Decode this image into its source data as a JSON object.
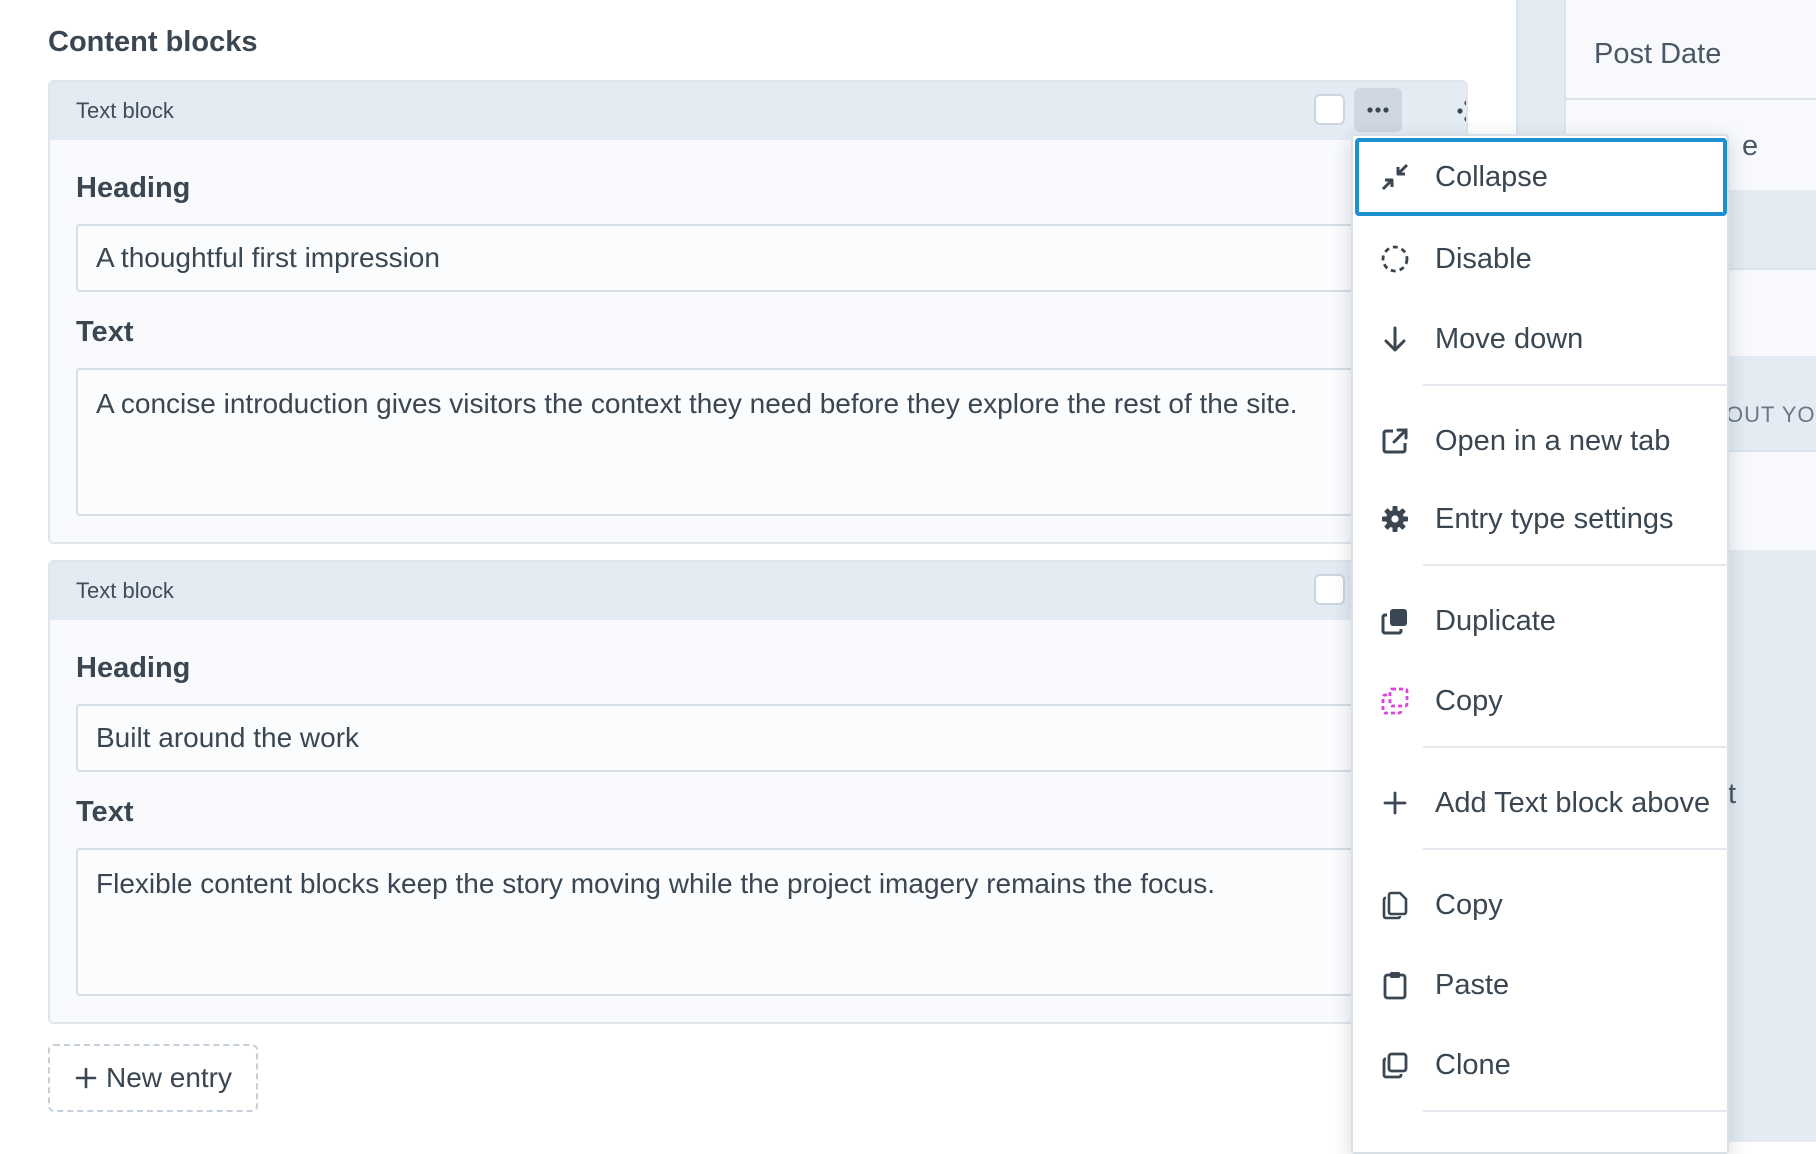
{
  "section": {
    "title": "Content blocks"
  },
  "blocks": [
    {
      "title": "Text block",
      "heading_label": "Heading",
      "heading_value": "A thoughtful first impression",
      "text_label": "Text",
      "text_value": "A concise introduction gives visitors the context they need before they explore the rest of the site."
    },
    {
      "title": "Text block",
      "heading_label": "Heading",
      "heading_value": "Built around the work",
      "text_label": "Text",
      "text_value": "Flexible content blocks keep the story moving while the project imagery remains the focus."
    }
  ],
  "new_entry": {
    "label": "New entry"
  },
  "sidebar": {
    "post_date_label": "Post Date",
    "fragment_1": "e",
    "fragment_caps": "OUT YOU",
    "fragment_2": "t"
  },
  "menu": {
    "items": [
      {
        "label": "Collapse",
        "icon": "collapse-icon"
      },
      {
        "label": "Disable",
        "icon": "disable-icon"
      },
      {
        "label": "Move down",
        "icon": "arrow-down-icon"
      },
      {
        "label": "Open in a new tab",
        "icon": "external-link-icon"
      },
      {
        "label": "Entry type settings",
        "icon": "gear-icon"
      },
      {
        "label": "Duplicate",
        "icon": "duplicate-icon"
      },
      {
        "label": "Copy",
        "icon": "copy-dashed-icon"
      },
      {
        "label": "Add Text block above",
        "icon": "plus-icon"
      },
      {
        "label": "Copy",
        "icon": "copy-icon"
      },
      {
        "label": "Paste",
        "icon": "clipboard-icon"
      },
      {
        "label": "Clone",
        "icon": "clone-icon"
      }
    ]
  },
  "colors": {
    "focus_ring": "#1e8fd0",
    "copy_icon_accent": "#e040e0",
    "block_header_bg": "#e4ebf3"
  }
}
